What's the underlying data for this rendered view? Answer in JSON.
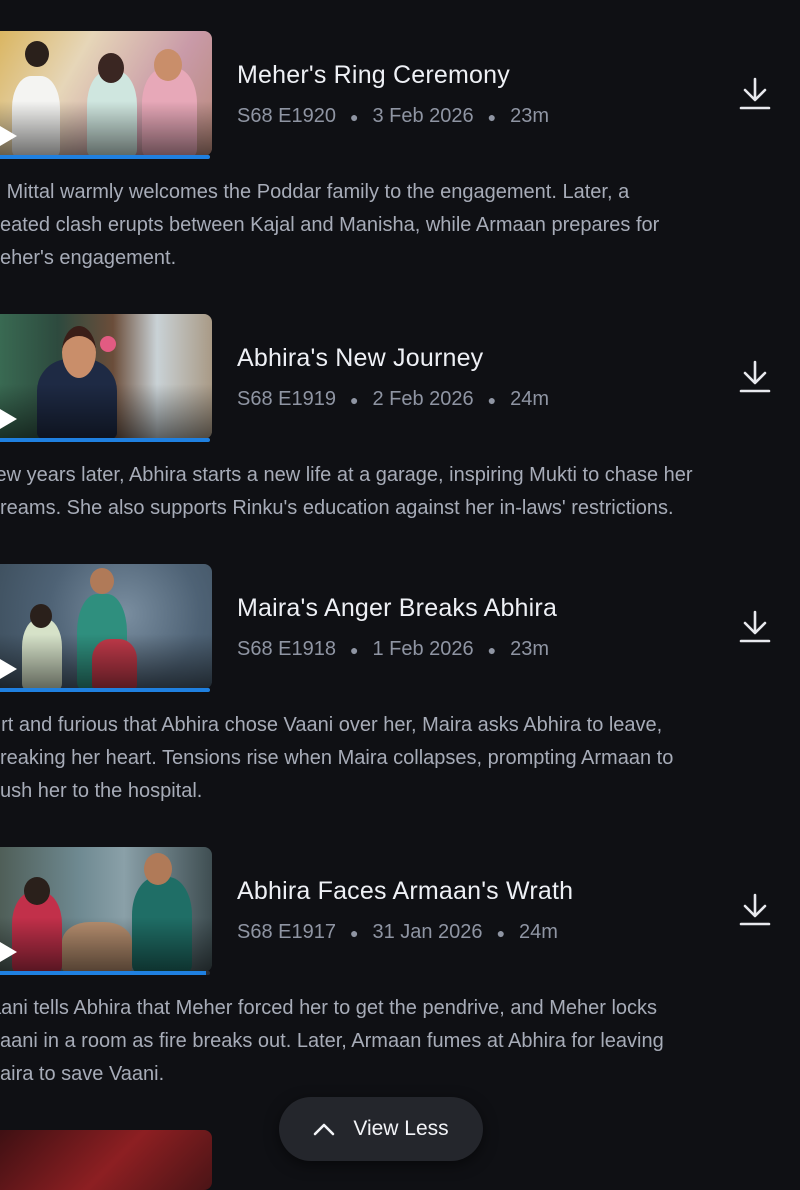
{
  "episodes": [
    {
      "title": "Meher's Ring Ceremony",
      "code": "S68 E1920",
      "date": "3 Feb 2026",
      "duration": "23m",
      "progress": 1.0,
      "description": [
        "r. Mittal warmly welcomes the Poddar family to the engagement. Later, a",
        "eated clash erupts between Kajal and Manisha, while Armaan prepares for",
        "eher's engagement."
      ]
    },
    {
      "title": "Abhira's New Journey",
      "code": "S68 E1919",
      "date": "2 Feb 2026",
      "duration": "24m",
      "progress": 1.0,
      "description": [
        "few years later, Abhira starts a new life at a garage, inspiring Mukti to chase her",
        "reams. She also supports Rinku's education against her in-laws' restrictions."
      ]
    },
    {
      "title": "Maira's Anger Breaks Abhira",
      "code": "S68 E1918",
      "date": "1 Feb 2026",
      "duration": "23m",
      "progress": 1.0,
      "description": [
        "urt and furious that Abhira chose Vaani over her, Maira asks Abhira to leave,",
        "reaking her heart. Tensions rise when Maira collapses, prompting Armaan to",
        "ush her to the hospital."
      ]
    },
    {
      "title": "Abhira Faces Armaan's Wrath",
      "code": "S68 E1917",
      "date": "31 Jan 2026",
      "duration": "24m",
      "progress": 0.98,
      "description": [
        "aani tells Abhira that Meher forced her to get the pendrive, and Meher locks",
        "aani in a room as fire breaks out. Later, Armaan fumes at Abhira for leaving",
        "aira to save Vaani."
      ]
    }
  ],
  "view_less_label": "View Less",
  "colors": {
    "background": "#0f1014",
    "progress_fill": "#1f80e0",
    "meta_text": "#8f95a3",
    "description_text": "#a7acb8"
  },
  "icons": {
    "download": "download-icon",
    "play": "play-icon",
    "chevron": "chevron-up-icon"
  }
}
